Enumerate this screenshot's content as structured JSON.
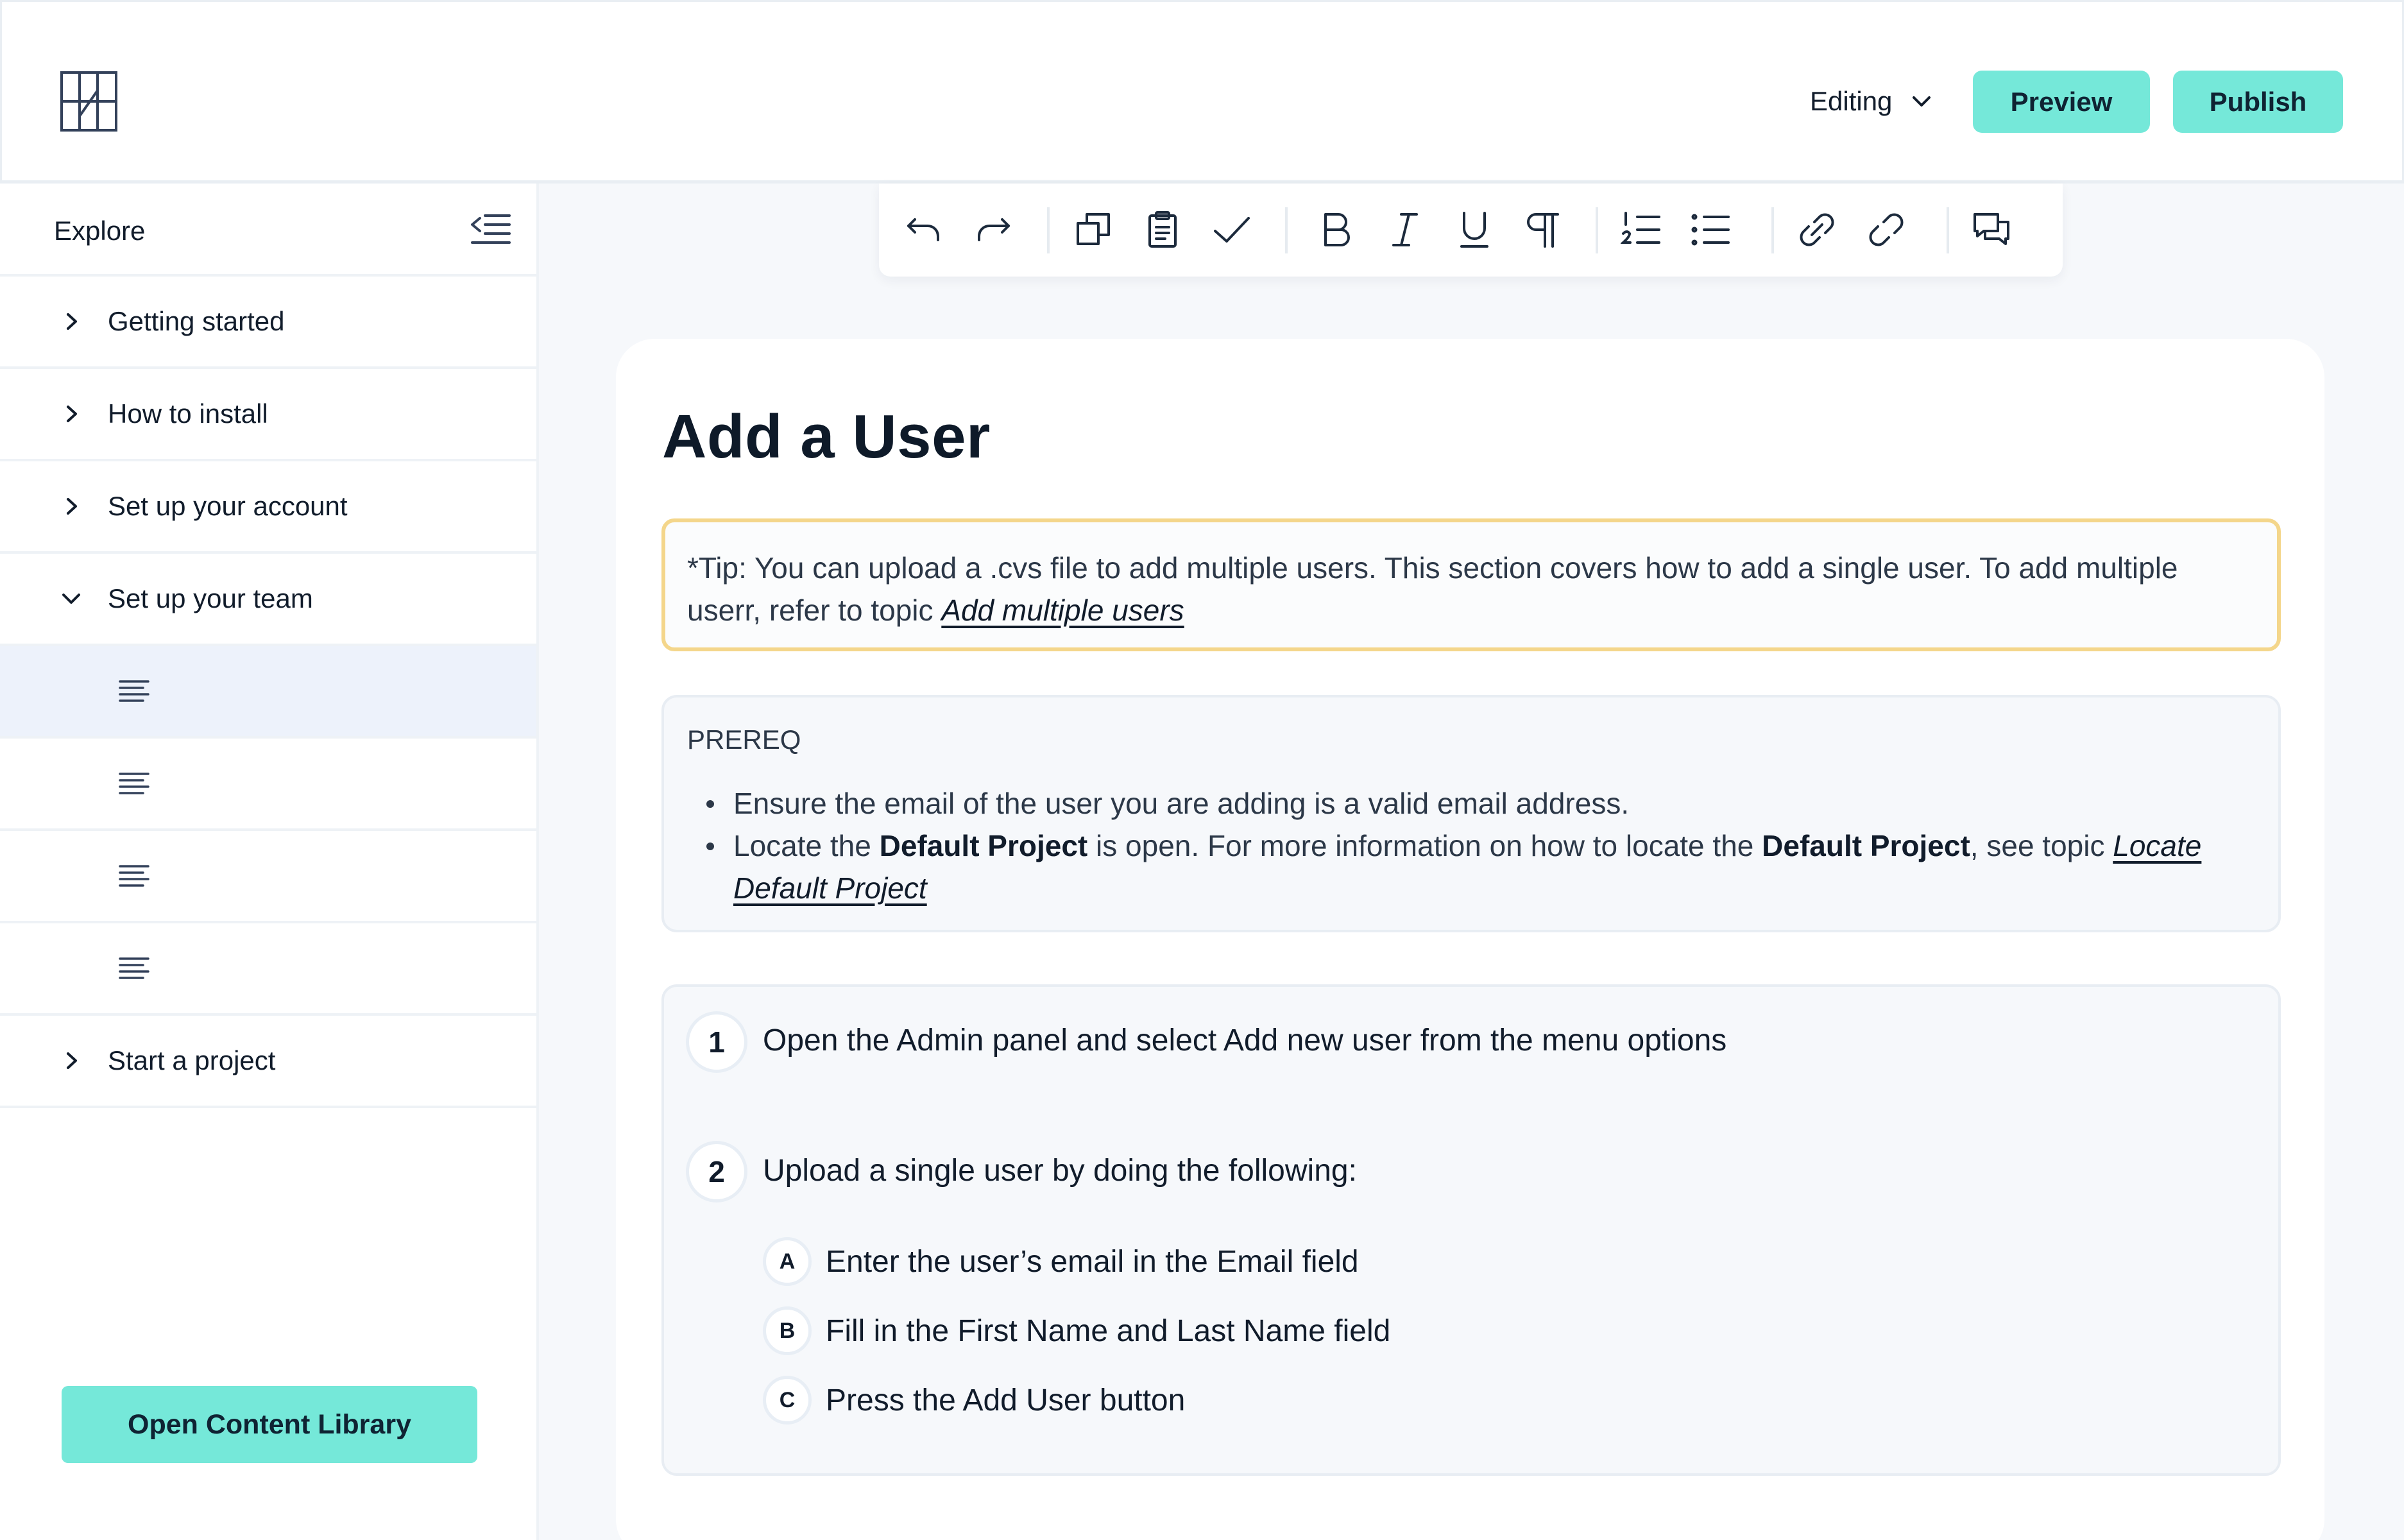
{
  "header": {
    "logo_icon": "grid-logo-icon",
    "mode_label": "Editing",
    "preview_label": "Preview",
    "publish_label": "Publish"
  },
  "sidebar": {
    "title": "Explore",
    "items": [
      {
        "label": "Getting started",
        "expanded": false
      },
      {
        "label": "How to install",
        "expanded": false
      },
      {
        "label": "Set up your account",
        "expanded": false
      },
      {
        "label": "Set up your team",
        "expanded": true
      },
      {
        "label": "Start a project",
        "expanded": false
      }
    ],
    "open_library_label": "Open Content Library"
  },
  "toolbar": {
    "tools": [
      "undo-icon",
      "redo-icon",
      "copy-icon",
      "clipboard-icon",
      "check-icon",
      "bold-icon",
      "italic-icon",
      "underline-icon",
      "paragraph-icon",
      "numbered-list-icon",
      "bulleted-list-icon",
      "link-icon",
      "unlink-icon",
      "comments-icon"
    ]
  },
  "doc": {
    "title": "Add a User",
    "tip_text": "*Tip: You can upload a .cvs file to add multiple users. This section covers how to add a single user. To add multiple userr, refer to topic ",
    "tip_link": "Add multiple users",
    "prereq": {
      "title": "PREREQ",
      "bullet1": "Ensure the email of the user you are adding is a valid email address.",
      "bullet2_a": "Locate the ",
      "bullet2_b": "Default Project",
      "bullet2_c": " is open. For more information on how to locate the ",
      "bullet2_d": "Default Project",
      "bullet2_e": ", see topic ",
      "bullet2_link": "Locate Default Project"
    },
    "steps": [
      {
        "num": "1",
        "text": "Open the Admin panel and select Add new user from the menu options"
      },
      {
        "num": "2",
        "text": "Upload a single user by doing the following:"
      }
    ],
    "substeps": [
      {
        "letter": "A",
        "text": "Enter the user’s email in the Email field"
      },
      {
        "letter": "B",
        "text": "Fill in the First Name and Last Name field"
      },
      {
        "letter": "C",
        "text": "Press the Add User button"
      }
    ]
  }
}
